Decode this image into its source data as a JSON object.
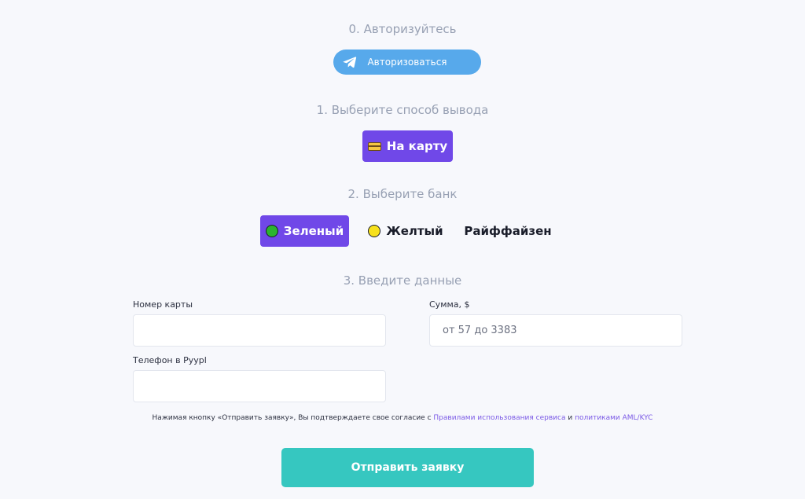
{
  "steps": {
    "auth_title": "0. Авторизуйтесь",
    "method_title": "1. Выберите способ вывода",
    "bank_title": "2. Выберите банк",
    "data_title": "3. Введите данные"
  },
  "auth": {
    "button_label": "Авторизоваться",
    "icon": "telegram-icon",
    "color": "#57a9eb"
  },
  "methods": [
    {
      "label": "На карту",
      "icon": "credit-card-icon",
      "selected": true
    }
  ],
  "banks": [
    {
      "label": "Зеленый",
      "icon": "green-circle-icon",
      "icon_color": "#2bb32f",
      "selected": true
    },
    {
      "label": "Желтый",
      "icon": "yellow-circle-icon",
      "icon_color": "#f7e11c",
      "selected": false
    },
    {
      "label": "Райффайзен",
      "icon": "",
      "selected": false
    }
  ],
  "form": {
    "card_number": {
      "label": "Номер карты",
      "value": "",
      "placeholder": ""
    },
    "amount": {
      "label": "Сумма, $",
      "value": "",
      "placeholder": "от 57 до 3383"
    },
    "phone": {
      "label": "Телефон в Pyypl",
      "value": "",
      "placeholder": ""
    }
  },
  "consent": {
    "text_before": "Нажимая кнопку «Отправить заявку», Вы подтверждаете свое согласие с ",
    "rules_link": "Правилами использования сервиса",
    "and": " и ",
    "policy_link": "политиками AML/KYC"
  },
  "submit": {
    "label": "Отправить заявку",
    "color": "#36c7c0"
  },
  "colors": {
    "accent": "#7048e8",
    "background": "#f7f8fc",
    "step_title": "#97a0b3",
    "link": "#7b5ae6"
  }
}
